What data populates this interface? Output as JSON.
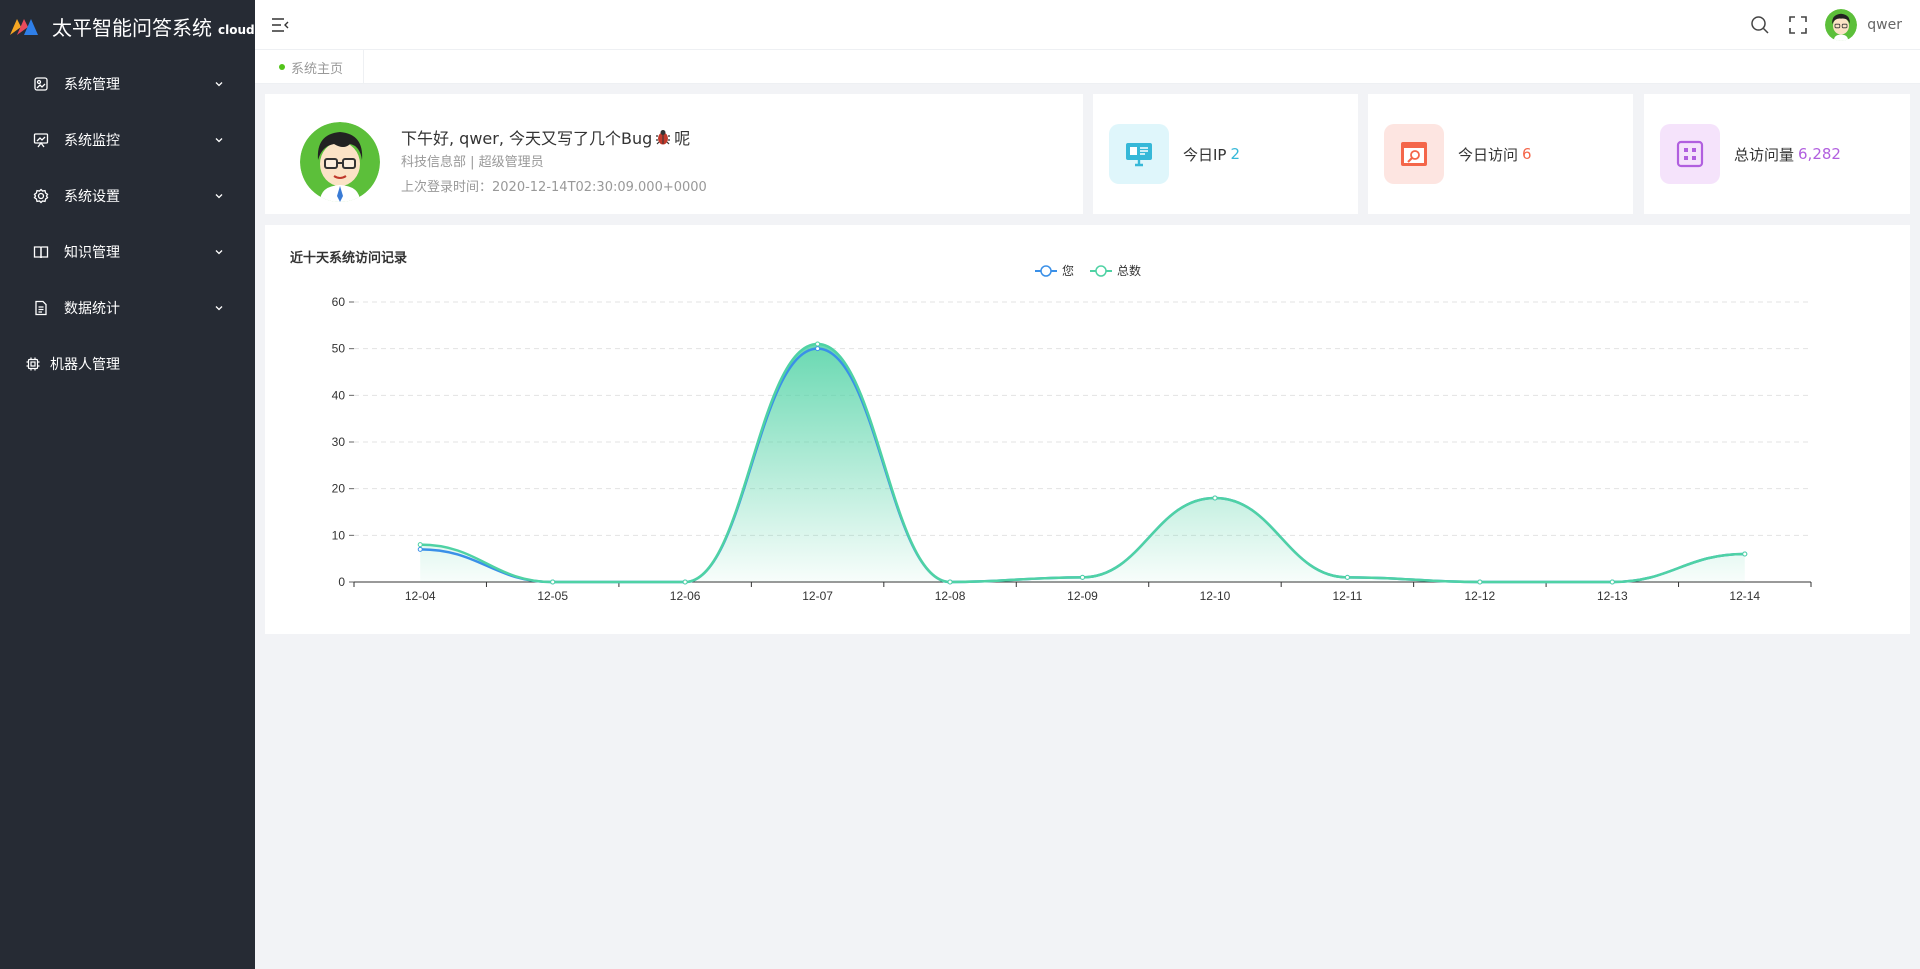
{
  "app": {
    "title": "太平智能问答系统",
    "subtitle": "cloud"
  },
  "sidebar": {
    "items": [
      {
        "label": "系统管理",
        "icon": "system-manage-icon"
      },
      {
        "label": "系统监控",
        "icon": "monitor-icon"
      },
      {
        "label": "系统设置",
        "icon": "settings-icon"
      },
      {
        "label": "知识管理",
        "icon": "book-icon"
      },
      {
        "label": "数据统计",
        "icon": "document-icon"
      },
      {
        "label": "机器人管理",
        "icon": "robot-icon"
      }
    ]
  },
  "topbar": {
    "username": "qwer"
  },
  "tabs": [
    {
      "label": "系统主页",
      "active": true
    }
  ],
  "welcome": {
    "greeting": "下午好, qwer, 今天又写了几个Bug",
    "greeting_suffix": "呢",
    "department": "科技信息部 | 超级管理员",
    "last_login_label": "上次登录时间：",
    "last_login": "2020-12-14T02:30:09.000+0000"
  },
  "stats": [
    {
      "label": "今日IP",
      "value": "2",
      "color": "#36b8d8",
      "icon": "monitor-screen-icon"
    },
    {
      "label": "今日访问",
      "value": "6",
      "color": "#f4664a",
      "icon": "browser-icon"
    },
    {
      "label": "总访问量",
      "value": "6,282",
      "color": "#b15fdf",
      "icon": "grid-icon"
    }
  ],
  "colors": {
    "sidebar_bg": "#262b34",
    "series_you": "#3a90e8",
    "series_total": "#4fd2a4"
  },
  "chart_data": {
    "type": "area",
    "title": "近十天系统访问记录",
    "categories": [
      "12-04",
      "12-05",
      "12-06",
      "12-07",
      "12-08",
      "12-09",
      "12-10",
      "12-11",
      "12-12",
      "12-13",
      "12-14"
    ],
    "series": [
      {
        "name": "您",
        "values": [
          7,
          0,
          0,
          50,
          0,
          1,
          18,
          1,
          0,
          0,
          6
        ]
      },
      {
        "name": "总数",
        "values": [
          8,
          0,
          0,
          51,
          0,
          1,
          18,
          1,
          0,
          0,
          6
        ]
      }
    ],
    "ylim": [
      0,
      60
    ],
    "yticks": [
      0,
      10,
      20,
      30,
      40,
      50,
      60
    ],
    "grid": true,
    "legend": "top-center",
    "smooth": true
  }
}
